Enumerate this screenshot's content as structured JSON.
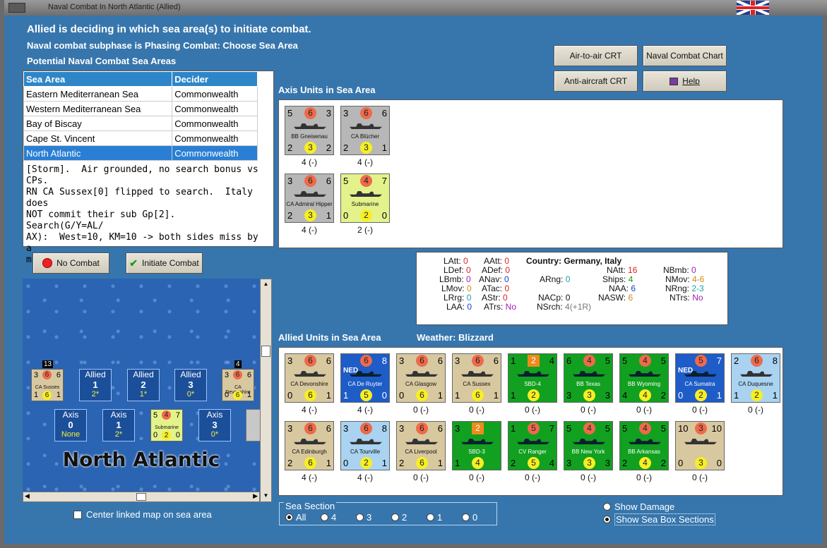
{
  "window": {
    "title": "Naval Combat In North Atlantic (Allied)"
  },
  "header": {
    "headline": "Allied is deciding in which sea area(s) to initiate combat.",
    "subphase": "Naval combat subphase is Phasing Combat: Choose Sea Area",
    "section_title": "Potential Naval Combat Sea Areas"
  },
  "buttons": {
    "air_to_air": "Air-to-air CRT",
    "naval_chart": "Naval Combat Chart",
    "anti_aircraft": "Anti-aircraft CRT",
    "help": "Help",
    "no_combat": "No Combat",
    "initiate_combat": "Initiate Combat"
  },
  "sea_table": {
    "headers": [
      "Sea Area",
      "Decider"
    ],
    "rows": [
      [
        "Eastern Mediterranean Sea",
        "Commonwealth"
      ],
      [
        "Western Mediterranean Sea",
        "Commonwealth"
      ],
      [
        "Bay of Biscay",
        "Commonwealth"
      ],
      [
        "Cape St. Vincent",
        "Commonwealth"
      ],
      [
        "North Atlantic",
        "Commonwealth"
      ]
    ],
    "selected_index": 4
  },
  "notes": "[Storm].  Air grounded, no search bonus vs CPs.\nRN CA Sussex[0] flipped to search.  Italy does\nNOT commit their sub Gp[2].  Search(G/Y=AL/\nAX):  West=10, KM=10 -> both sides miss by a\nmile finding.",
  "axis": {
    "label": "Axis Units in Sea Area",
    "units": [
      {
        "name": "BB Gneisenau",
        "tl": "5",
        "top": "6",
        "tr": "3",
        "bl": "2",
        "bot": "3",
        "br": "2",
        "dmg": "4 (-)",
        "color": "gray"
      },
      {
        "name": "CA Blücher",
        "tl": "3",
        "top": "6",
        "tr": "6",
        "bl": "2",
        "bot": "3",
        "br": "1",
        "dmg": "4 (-)",
        "color": "gray"
      },
      {
        "name": "CA Admiral Hipper",
        "tl": "3",
        "top": "6",
        "tr": "6",
        "bl": "2",
        "bot": "3",
        "br": "1",
        "dmg": "4 (-)",
        "color": "gray"
      },
      {
        "name": "Submarine",
        "tl": "5",
        "top": "4",
        "tr": "7",
        "bl": "0",
        "bot": "2",
        "br": "0",
        "dmg": "2 (-)",
        "color": "lime"
      }
    ]
  },
  "stats": {
    "country_label": "Country: Germany, Italy",
    "LAtt": "0",
    "LDef": "0",
    "LBmb": "0",
    "LMov": "0",
    "LRrg": "0",
    "LAA": "0",
    "AAtt": "0",
    "ADef": "0",
    "ANav": "0",
    "ATac": "0",
    "AStr": "0",
    "ATrs": "No",
    "ARng": "0",
    "NACp": "0",
    "NSrch": "4(+1R)",
    "NAtt": "16",
    "Ships": "4",
    "NAA": "6",
    "NASW": "6",
    "NBmb": "0",
    "NMov": "4-6",
    "NRng": "2-3",
    "NTrs": "No"
  },
  "allied": {
    "label": "Allied Units in Sea Area",
    "weather": "Weather:  Blizzard",
    "units": [
      {
        "name": "CA Devonshire",
        "tl": "3",
        "top": "6",
        "tr": "6",
        "bl": "0",
        "bot": "6",
        "br": "1",
        "dmg": "4 (-)",
        "color": "tan"
      },
      {
        "name": "CA De Ruyter",
        "tl": "NED",
        "top": "6",
        "tr": "8",
        "bl": "1",
        "bot": "5",
        "br": "0",
        "dmg": "4 (-)",
        "color": "navy"
      },
      {
        "name": "CA Glasgow",
        "tl": "3",
        "top": "6",
        "tr": "6",
        "bl": "0",
        "bot": "6",
        "br": "1",
        "dmg": "0 (-)",
        "color": "tan"
      },
      {
        "name": "CA Sussex",
        "tl": "3",
        "top": "6",
        "tr": "6",
        "bl": "1",
        "bot": "6",
        "br": "1",
        "dmg": "0 (-)",
        "color": "tan"
      },
      {
        "name": "SBD-4",
        "tl": "1",
        "top": "2",
        "tr": "4",
        "bl": "1",
        "bot": "2",
        "br": "",
        "dmg": "0 (-)",
        "color": "green"
      },
      {
        "name": "BB Texas",
        "tl": "6",
        "top": "4",
        "tr": "5",
        "bl": "3",
        "bot": "3",
        "br": "3",
        "dmg": "0 (-)",
        "color": "green"
      },
      {
        "name": "BB Wyoming",
        "tl": "5",
        "top": "4",
        "tr": "5",
        "bl": "4",
        "bot": "4",
        "br": "2",
        "dmg": "0 (-)",
        "color": "green"
      },
      {
        "name": "CA Sumatra",
        "tl": "NED",
        "top": "5",
        "tr": "7",
        "bl": "0",
        "bot": "2",
        "br": "1",
        "dmg": "0 (-)",
        "color": "navy"
      },
      {
        "name": "CA Duquesne",
        "tl": "2",
        "top": "6",
        "tr": "8",
        "bl": "1",
        "bot": "2",
        "br": "1",
        "dmg": "0 (-)",
        "color": "lblue"
      },
      {
        "name": "CA Edinburgh",
        "tl": "3",
        "top": "6",
        "tr": "6",
        "bl": "2",
        "bot": "6",
        "br": "1",
        "dmg": "4 (-)",
        "color": "tan"
      },
      {
        "name": "CA Tourville",
        "tl": "3",
        "top": "6",
        "tr": "8",
        "bl": "0",
        "bot": "2",
        "br": "1",
        "dmg": "4 (-)",
        "color": "lblue"
      },
      {
        "name": "CA Liverpool",
        "tl": "3",
        "top": "6",
        "tr": "6",
        "bl": "2",
        "bot": "6",
        "br": "1",
        "dmg": "0 (-)",
        "color": "tan"
      },
      {
        "name": "SBD-3",
        "tl": "3",
        "top": "2",
        "tr": "",
        "bl": "1",
        "bot": "4",
        "br": "",
        "dmg": "0 (-)",
        "color": "green"
      },
      {
        "name": "CV Ranger",
        "tl": "1",
        "top": "5",
        "tr": "7",
        "bl": "2",
        "bot": "5",
        "br": "4",
        "dmg": "0 (-)",
        "color": "green"
      },
      {
        "name": "BB New York",
        "tl": "5",
        "top": "4",
        "tr": "5",
        "bl": "3",
        "bot": "3",
        "br": "3",
        "dmg": "0 (-)",
        "color": "green"
      },
      {
        "name": "BB Arkansas",
        "tl": "5",
        "top": "4",
        "tr": "5",
        "bl": "2",
        "bot": "4",
        "br": "2",
        "dmg": "0 (-)",
        "color": "green"
      },
      {
        "name": "",
        "tl": "10",
        "top": "3",
        "tr": "10",
        "bl": "0",
        "bot": "3",
        "br": "0",
        "dmg": "0 (-)",
        "color": "tan"
      }
    ]
  },
  "map": {
    "title": "North Atlantic",
    "allied_boxes": [
      {
        "label": "Allied",
        "num": "1",
        "val": "2*"
      },
      {
        "label": "Allied",
        "num": "2",
        "val": "1*"
      },
      {
        "label": "Allied",
        "num": "3",
        "val": "0*"
      }
    ],
    "axis_boxes": [
      {
        "label": "Axis",
        "num": "0",
        "val": "None"
      },
      {
        "label": "Axis",
        "num": "1",
        "val": "2*"
      },
      {
        "label": "Axis",
        "num": "3",
        "val": "0*"
      }
    ],
    "mini_units": [
      {
        "name": "CA Sussex",
        "badge": "13",
        "tl": "3",
        "top": "6",
        "tr": "6",
        "bl": "1",
        "bot": "6",
        "br": "1"
      },
      {
        "name": "CA Devonshire",
        "badge": "4",
        "tl": "3",
        "top": "6",
        "tr": "6",
        "bl": "0",
        "bot": "6",
        "br": "1"
      },
      {
        "name": "Submarine",
        "tl": "5",
        "top": "4",
        "tr": "7",
        "bl": "0",
        "bot": "2",
        "br": "0"
      }
    ],
    "center_checkbox": "Center linked map on sea area"
  },
  "sea_section": {
    "label": "Sea Section",
    "options": [
      "All",
      "4",
      "3",
      "2",
      "1",
      "0"
    ],
    "selected": "All"
  },
  "view_options": {
    "show_damage": "Show Damage",
    "show_sea_box": "Show Sea Box Sections",
    "selected": "show_sea_box"
  },
  "colors": {
    "accent": "#2a7fd4",
    "sea": "#3776ad",
    "allied_green": "#12a021"
  }
}
